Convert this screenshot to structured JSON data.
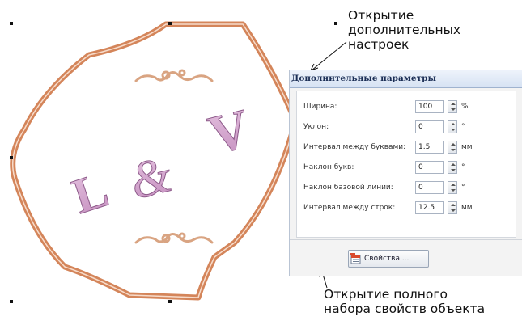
{
  "callouts": {
    "top_lines": [
      "Открытие",
      "дополнительных",
      "настроек"
    ],
    "bottom_lines": [
      "Открытие полного",
      "набора свойств объекта"
    ]
  },
  "artwork": {
    "letters": {
      "left": "L",
      "middle": "&",
      "right": "V"
    },
    "colors": {
      "outline": "#d4855a",
      "letters": "#d6a6cf",
      "ornament": "#d9a482"
    }
  },
  "panel": {
    "title": "Дополнительные параметры",
    "rows": [
      {
        "label": "Ширина:",
        "value": "100",
        "unit": "%"
      },
      {
        "label": "Уклон:",
        "value": "0",
        "unit": "°"
      },
      {
        "label": "Интервал между буквами:",
        "value": "1.5",
        "unit": "мм"
      },
      {
        "label": "Наклон букв:",
        "value": "0",
        "unit": "°"
      },
      {
        "label": "Наклон базовой линии:",
        "value": "0",
        "unit": "°"
      },
      {
        "label": "Интервал между строк:",
        "value": "12.5",
        "unit": "мм"
      }
    ],
    "properties_button": "Свойства ..."
  }
}
